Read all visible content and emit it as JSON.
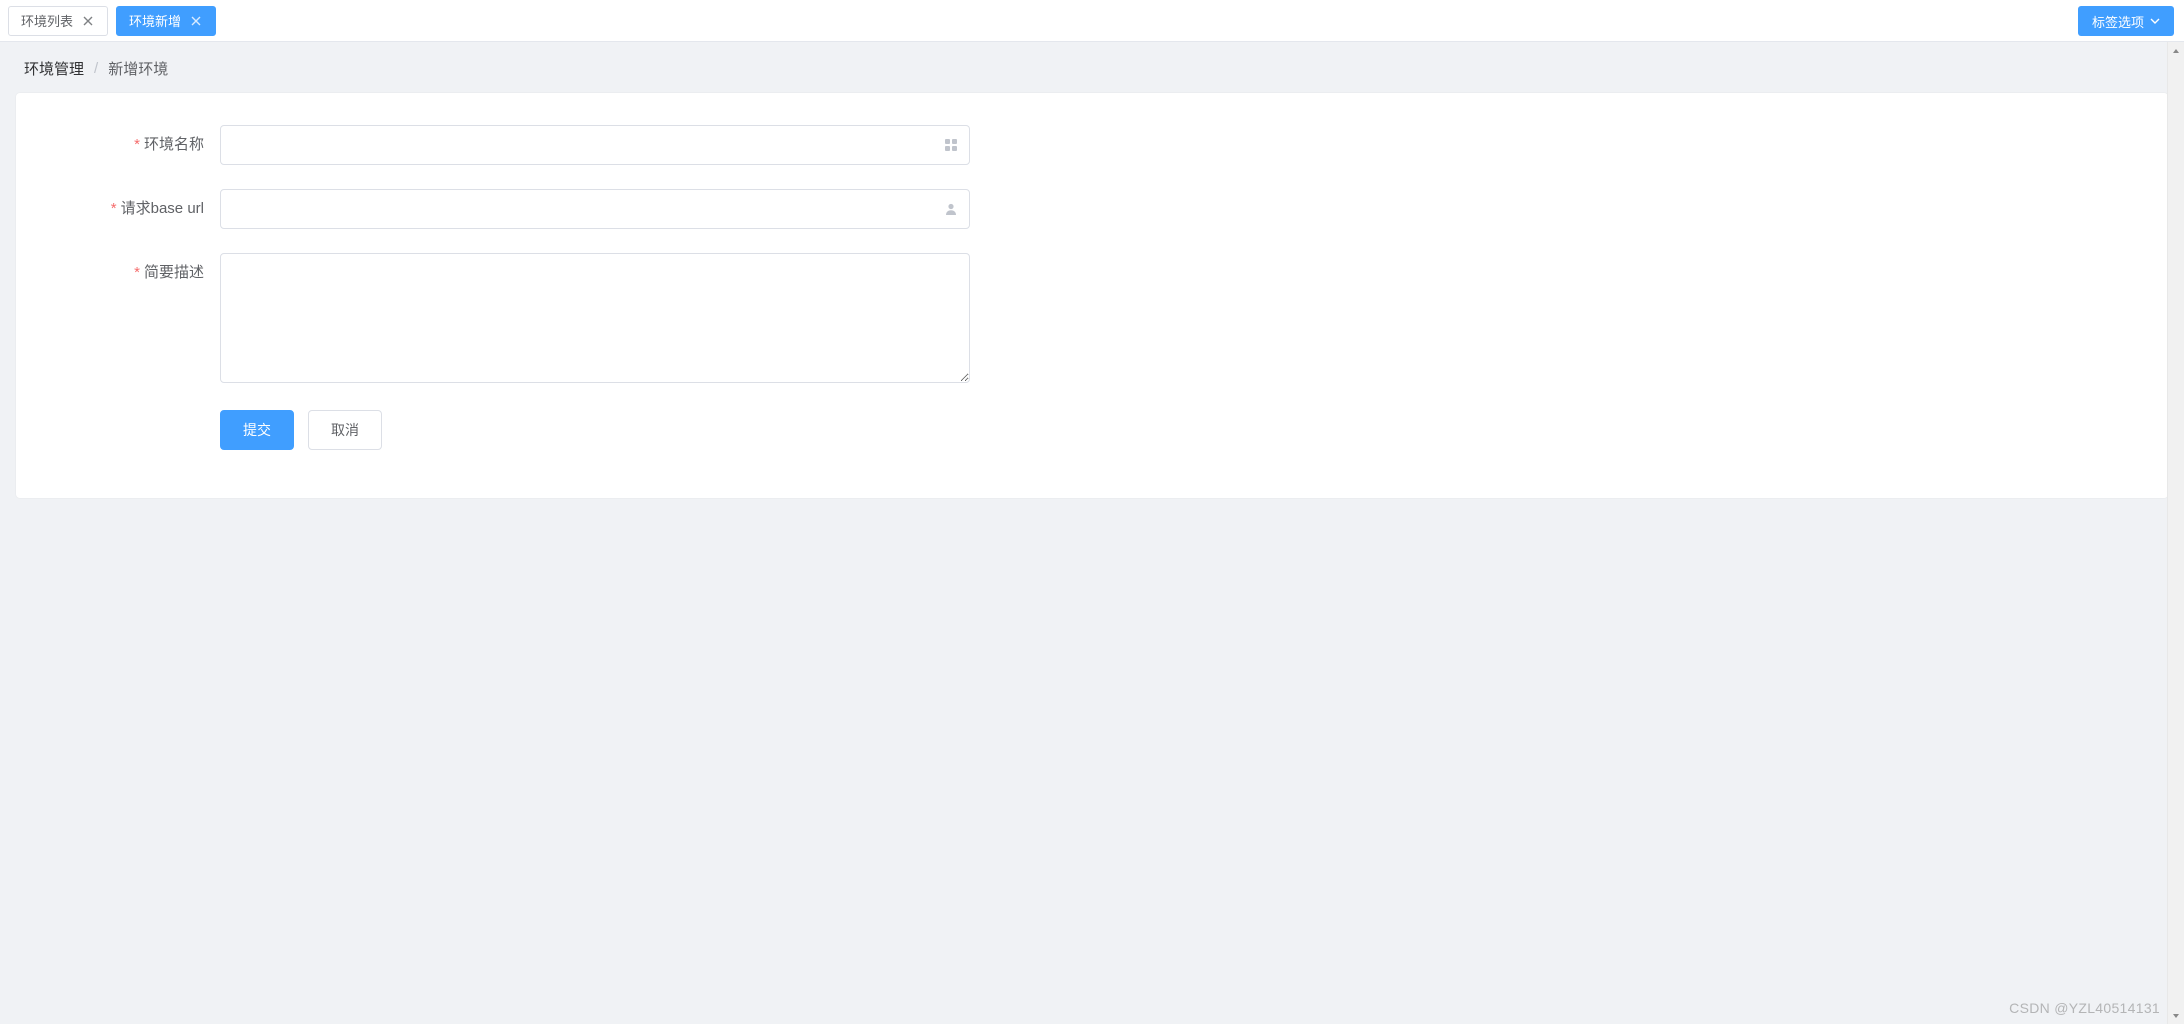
{
  "tabs": {
    "items": [
      {
        "label": "环境列表",
        "active": false
      },
      {
        "label": "环境新增",
        "active": true
      }
    ],
    "options_label": "标签选项"
  },
  "breadcrumb": {
    "root": "环境管理",
    "current": "新增环境",
    "separator": "/"
  },
  "form": {
    "env_name": {
      "label": "环境名称",
      "value": "",
      "required": true
    },
    "base_url": {
      "label": "请求base url",
      "value": "",
      "required": true
    },
    "description": {
      "label": "简要描述",
      "value": "",
      "required": true
    },
    "submit_label": "提交",
    "cancel_label": "取消"
  },
  "watermark": "CSDN @YZL40514131",
  "icons": {
    "close": "close-icon",
    "grid": "grid-icon",
    "user": "user-icon",
    "chevron_down": "chevron-down-icon"
  }
}
